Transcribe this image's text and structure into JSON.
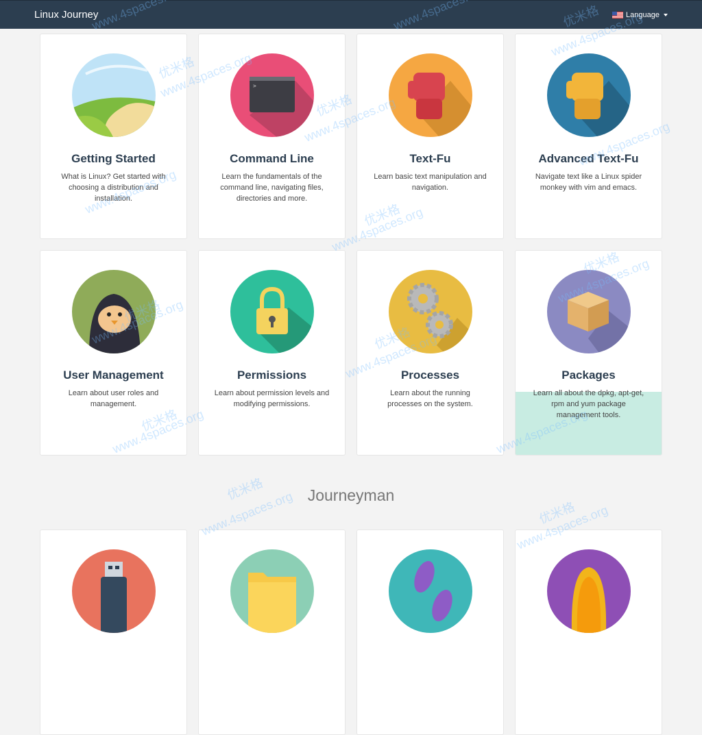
{
  "navbar": {
    "brand": "Linux Journey",
    "language": "Language",
    "flag_icon": "us-flag-icon"
  },
  "colors": {
    "navbar": "#2c3e50",
    "background": "#f3f3f3",
    "card_highlight": "#c8ece2"
  },
  "cards": [
    {
      "title": "Getting Started",
      "desc": "What is Linux? Get started with choosing a distribution and installation.",
      "icon": "landscape-icon",
      "color": "#bfe3f7"
    },
    {
      "title": "Command Line",
      "desc": "Learn the fundamentals of the command line, navigating files, directories and more.",
      "icon": "terminal-icon",
      "color": "#e94e77"
    },
    {
      "title": "Text-Fu",
      "desc": "Learn basic text manipulation and navigation.",
      "icon": "red-fist-icon",
      "color": "#f5a742"
    },
    {
      "title": "Advanced Text-Fu",
      "desc": "Navigate text like a Linux spider monkey with vim and emacs.",
      "icon": "yellow-fist-icon",
      "color": "#2f7ea8"
    },
    {
      "title": "User Management",
      "desc": "Learn about user roles and management.",
      "icon": "penguin-icon",
      "color": "#8fab59"
    },
    {
      "title": "Permissions",
      "desc": "Learn about permission levels and modifying permissions.",
      "icon": "padlock-icon",
      "color": "#2ebf9b"
    },
    {
      "title": "Processes",
      "desc": "Learn about the running processes on the system.",
      "icon": "gears-icon",
      "color": "#e8bc42"
    },
    {
      "title": "Packages",
      "desc": "Learn all about the dpkg, apt-get, rpm and yum package management tools.",
      "icon": "package-box-icon",
      "color": "#8b8ac2"
    }
  ],
  "section": {
    "title": "Journeyman"
  },
  "journeyman_cards": [
    {
      "icon": "usb-drive-icon",
      "color": "#e8735e"
    },
    {
      "icon": "folder-icon",
      "color": "#8ccfb5"
    },
    {
      "icon": "footprints-icon",
      "color": "#3fb7b8"
    },
    {
      "icon": "tux-icon",
      "color": "#8e4fb5"
    }
  ],
  "watermarks": [
    "www.4spaces.org",
    "优米格"
  ]
}
